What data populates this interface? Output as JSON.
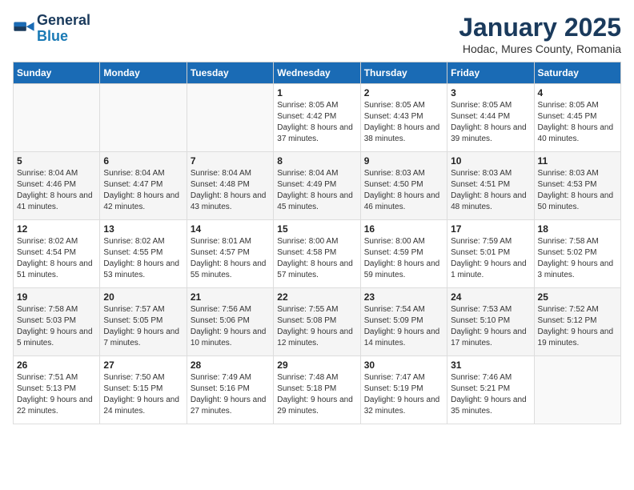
{
  "logo": {
    "line1": "General",
    "line2": "Blue"
  },
  "title": "January 2025",
  "subtitle": "Hodac, Mures County, Romania",
  "weekdays": [
    "Sunday",
    "Monday",
    "Tuesday",
    "Wednesday",
    "Thursday",
    "Friday",
    "Saturday"
  ],
  "weeks": [
    [
      {
        "day": "",
        "info": ""
      },
      {
        "day": "",
        "info": ""
      },
      {
        "day": "",
        "info": ""
      },
      {
        "day": "1",
        "info": "Sunrise: 8:05 AM\nSunset: 4:42 PM\nDaylight: 8 hours and 37 minutes."
      },
      {
        "day": "2",
        "info": "Sunrise: 8:05 AM\nSunset: 4:43 PM\nDaylight: 8 hours and 38 minutes."
      },
      {
        "day": "3",
        "info": "Sunrise: 8:05 AM\nSunset: 4:44 PM\nDaylight: 8 hours and 39 minutes."
      },
      {
        "day": "4",
        "info": "Sunrise: 8:05 AM\nSunset: 4:45 PM\nDaylight: 8 hours and 40 minutes."
      }
    ],
    [
      {
        "day": "5",
        "info": "Sunrise: 8:04 AM\nSunset: 4:46 PM\nDaylight: 8 hours and 41 minutes."
      },
      {
        "day": "6",
        "info": "Sunrise: 8:04 AM\nSunset: 4:47 PM\nDaylight: 8 hours and 42 minutes."
      },
      {
        "day": "7",
        "info": "Sunrise: 8:04 AM\nSunset: 4:48 PM\nDaylight: 8 hours and 43 minutes."
      },
      {
        "day": "8",
        "info": "Sunrise: 8:04 AM\nSunset: 4:49 PM\nDaylight: 8 hours and 45 minutes."
      },
      {
        "day": "9",
        "info": "Sunrise: 8:03 AM\nSunset: 4:50 PM\nDaylight: 8 hours and 46 minutes."
      },
      {
        "day": "10",
        "info": "Sunrise: 8:03 AM\nSunset: 4:51 PM\nDaylight: 8 hours and 48 minutes."
      },
      {
        "day": "11",
        "info": "Sunrise: 8:03 AM\nSunset: 4:53 PM\nDaylight: 8 hours and 50 minutes."
      }
    ],
    [
      {
        "day": "12",
        "info": "Sunrise: 8:02 AM\nSunset: 4:54 PM\nDaylight: 8 hours and 51 minutes."
      },
      {
        "day": "13",
        "info": "Sunrise: 8:02 AM\nSunset: 4:55 PM\nDaylight: 8 hours and 53 minutes."
      },
      {
        "day": "14",
        "info": "Sunrise: 8:01 AM\nSunset: 4:57 PM\nDaylight: 8 hours and 55 minutes."
      },
      {
        "day": "15",
        "info": "Sunrise: 8:00 AM\nSunset: 4:58 PM\nDaylight: 8 hours and 57 minutes."
      },
      {
        "day": "16",
        "info": "Sunrise: 8:00 AM\nSunset: 4:59 PM\nDaylight: 8 hours and 59 minutes."
      },
      {
        "day": "17",
        "info": "Sunrise: 7:59 AM\nSunset: 5:01 PM\nDaylight: 9 hours and 1 minute."
      },
      {
        "day": "18",
        "info": "Sunrise: 7:58 AM\nSunset: 5:02 PM\nDaylight: 9 hours and 3 minutes."
      }
    ],
    [
      {
        "day": "19",
        "info": "Sunrise: 7:58 AM\nSunset: 5:03 PM\nDaylight: 9 hours and 5 minutes."
      },
      {
        "day": "20",
        "info": "Sunrise: 7:57 AM\nSunset: 5:05 PM\nDaylight: 9 hours and 7 minutes."
      },
      {
        "day": "21",
        "info": "Sunrise: 7:56 AM\nSunset: 5:06 PM\nDaylight: 9 hours and 10 minutes."
      },
      {
        "day": "22",
        "info": "Sunrise: 7:55 AM\nSunset: 5:08 PM\nDaylight: 9 hours and 12 minutes."
      },
      {
        "day": "23",
        "info": "Sunrise: 7:54 AM\nSunset: 5:09 PM\nDaylight: 9 hours and 14 minutes."
      },
      {
        "day": "24",
        "info": "Sunrise: 7:53 AM\nSunset: 5:10 PM\nDaylight: 9 hours and 17 minutes."
      },
      {
        "day": "25",
        "info": "Sunrise: 7:52 AM\nSunset: 5:12 PM\nDaylight: 9 hours and 19 minutes."
      }
    ],
    [
      {
        "day": "26",
        "info": "Sunrise: 7:51 AM\nSunset: 5:13 PM\nDaylight: 9 hours and 22 minutes."
      },
      {
        "day": "27",
        "info": "Sunrise: 7:50 AM\nSunset: 5:15 PM\nDaylight: 9 hours and 24 minutes."
      },
      {
        "day": "28",
        "info": "Sunrise: 7:49 AM\nSunset: 5:16 PM\nDaylight: 9 hours and 27 minutes."
      },
      {
        "day": "29",
        "info": "Sunrise: 7:48 AM\nSunset: 5:18 PM\nDaylight: 9 hours and 29 minutes."
      },
      {
        "day": "30",
        "info": "Sunrise: 7:47 AM\nSunset: 5:19 PM\nDaylight: 9 hours and 32 minutes."
      },
      {
        "day": "31",
        "info": "Sunrise: 7:46 AM\nSunset: 5:21 PM\nDaylight: 9 hours and 35 minutes."
      },
      {
        "day": "",
        "info": ""
      }
    ]
  ]
}
